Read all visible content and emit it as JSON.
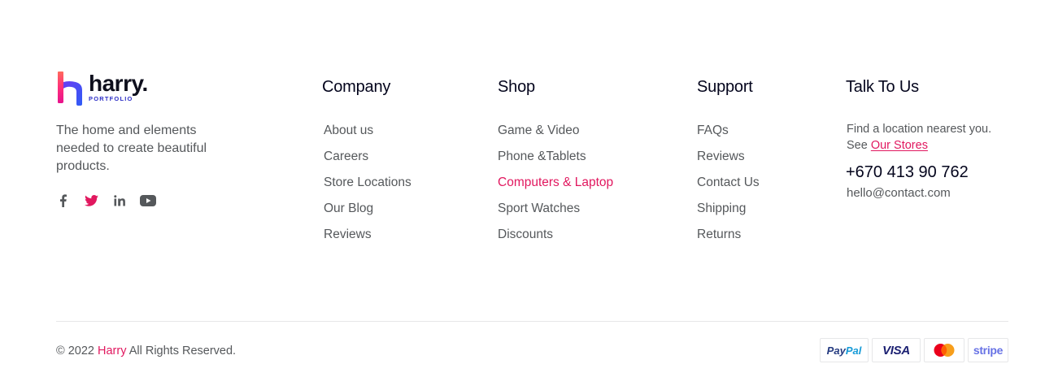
{
  "brand": {
    "name": "harry.",
    "subtitle": "PORTFOLIO",
    "tagline": "The home and elements needed to create beautiful products."
  },
  "social": {
    "icons": [
      "facebook-icon",
      "twitter-icon",
      "linkedin-icon",
      "youtube-icon"
    ],
    "twitter_color": "#e1185f"
  },
  "company": {
    "heading": "Company",
    "items": [
      "About us",
      "Careers",
      "Store Locations",
      "Our Blog",
      "Reviews"
    ]
  },
  "shop": {
    "heading": "Shop",
    "items": [
      "Game & Video",
      "Phone &Tablets",
      "Computers & Laptop",
      "Sport Watches",
      "Discounts"
    ],
    "active_index": 2
  },
  "support": {
    "heading": "Support",
    "items": [
      "FAQs",
      "Reviews",
      "Contact Us",
      "Shipping",
      "Returns"
    ]
  },
  "talk": {
    "heading": "Talk To Us",
    "text": "Find a location nearest you. See",
    "stores_link": "Our Stores",
    "phone": "+670 413 90 762",
    "email": "hello@contact.com"
  },
  "copyright": {
    "prefix": "© 2022",
    "brand": "Harry",
    "suffix": "All Rights Reserved."
  },
  "payments": {
    "paypal_a": "Pay",
    "paypal_b": "Pal",
    "visa": "VISA",
    "stripe": "stripe"
  },
  "colors": {
    "accent": "#e1185f",
    "heading": "#03041c",
    "body": "#55585b",
    "divider": "#e6e7e8"
  }
}
